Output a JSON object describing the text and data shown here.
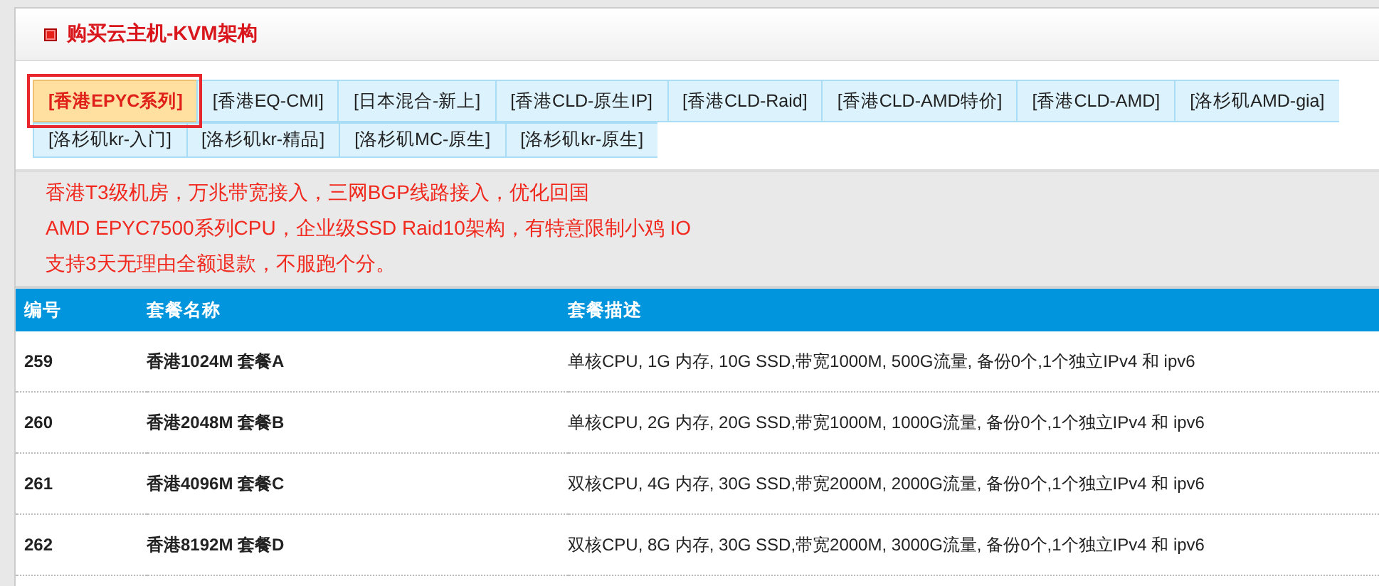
{
  "panel": {
    "title": "购买云主机-KVM架构"
  },
  "tabs": [
    {
      "label": "[香港EPYC系列]",
      "selected": true
    },
    {
      "label": "[香港EQ-CMI]",
      "selected": false
    },
    {
      "label": "[日本混合-新上]",
      "selected": false
    },
    {
      "label": "[香港CLD-原生IP]",
      "selected": false
    },
    {
      "label": "[香港CLD-Raid]",
      "selected": false
    },
    {
      "label": "[香港CLD-AMD特价]",
      "selected": false
    },
    {
      "label": "[香港CLD-AMD]",
      "selected": false
    },
    {
      "label": "[洛杉矶AMD-gia]",
      "selected": false
    },
    {
      "label": "[洛杉矶kr-入门]",
      "selected": false
    },
    {
      "label": "[洛杉矶kr-精品]",
      "selected": false
    },
    {
      "label": "[洛杉矶MC-原生]",
      "selected": false
    },
    {
      "label": "[洛杉矶kr-原生]",
      "selected": false
    }
  ],
  "notice": [
    "香港T3级机房，万兆带宽接入，三网BGP线路接入，优化回国",
    "AMD EPYC7500系列CPU，企业级SSD Raid10架构，有特意限制小鸡 IO",
    "支持3天无理由全额退款，不服跑个分。"
  ],
  "table": {
    "columns": [
      "编号",
      "套餐名称",
      "套餐描述"
    ],
    "rows": [
      [
        "259",
        "香港1024M 套餐A",
        "单核CPU, 1G 内存, 10G SSD,带宽1000M, 500G流量, 备份0个,1个独立IPv4 和 ipv6"
      ],
      [
        "260",
        "香港2048M 套餐B",
        "单核CPU, 2G 内存, 20G SSD,带宽1000M, 1000G流量, 备份0个,1个独立IPv4 和 ipv6"
      ],
      [
        "261",
        "香港4096M 套餐C",
        "双核CPU, 4G 内存, 30G SSD,带宽2000M, 2000G流量, 备份0个,1个独立IPv4 和 ipv6"
      ],
      [
        "262",
        "香港8192M 套餐D",
        "双核CPU, 8G 内存, 30G SSD,带宽2000M, 3000G流量, 备份0个,1个独立IPv4 和 ipv6"
      ]
    ]
  }
}
